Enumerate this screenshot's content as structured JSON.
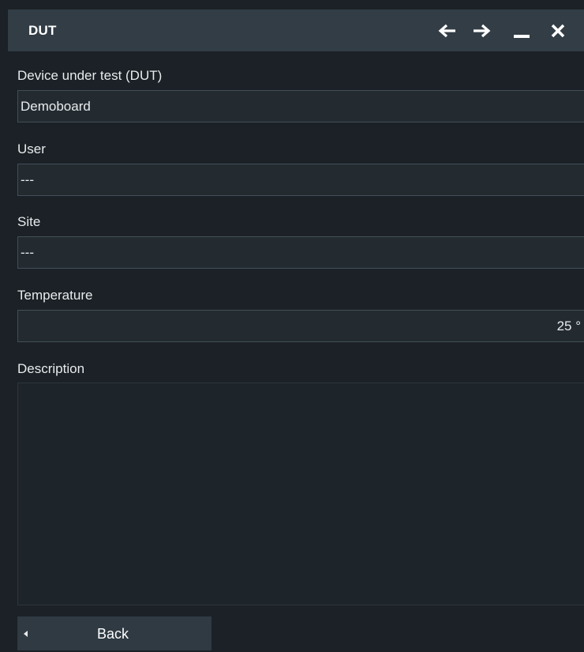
{
  "window": {
    "title": "DUT"
  },
  "form": {
    "dut_label": "Device under test (DUT)",
    "dut_value": "Demoboard",
    "user_label": "User",
    "user_value": "---",
    "site_label": "Site",
    "site_value": "---",
    "temperature_label": "Temperature",
    "temperature_value": "25 °",
    "description_label": "Description",
    "description_value": ""
  },
  "footer": {
    "back_label": "Back"
  },
  "icons": {
    "back": "arrow-left-icon",
    "forward": "arrow-right-icon",
    "minimize": "minimize-icon",
    "close": "close-icon",
    "back_button": "triangle-left-icon"
  },
  "colors": {
    "background": "#1b2126",
    "titlebar": "#323d46",
    "field": "#232b31",
    "field_border": "#434e57",
    "button": "#2f3a43",
    "text": "#e8ebee"
  }
}
